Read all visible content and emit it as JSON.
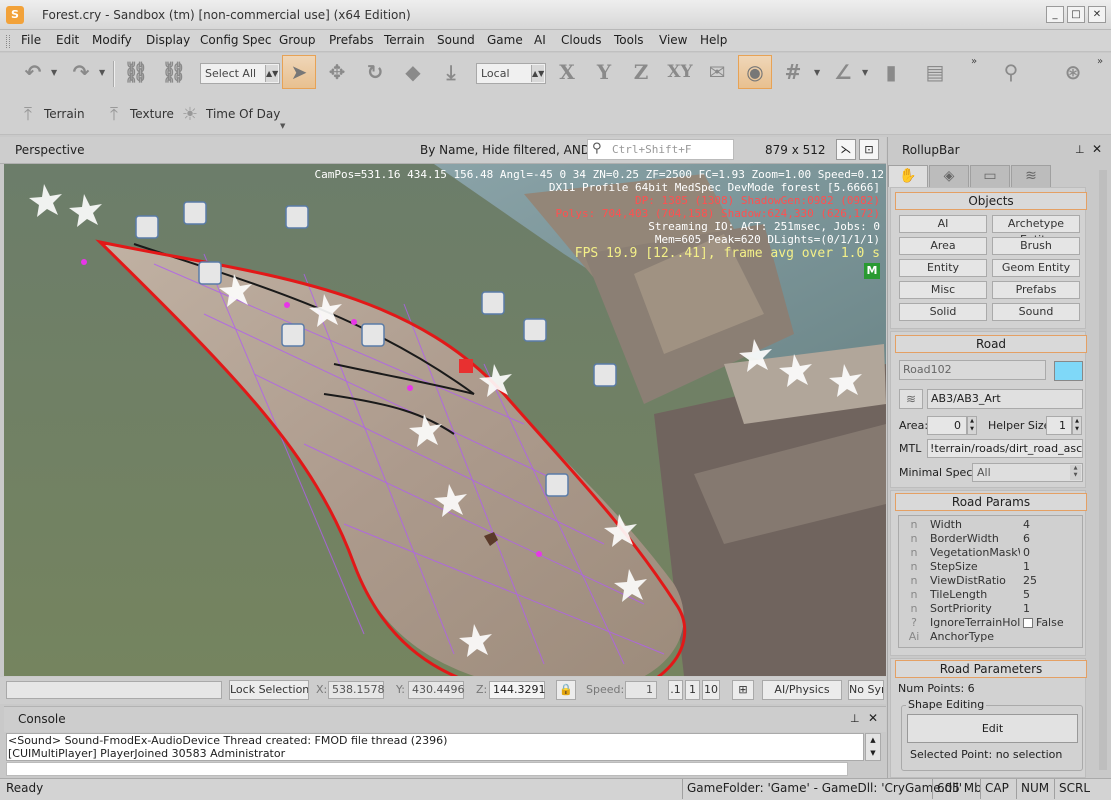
{
  "window": {
    "title": "Forest.cry - Sandbox (tm) [non-commercial use] (x64 Edition)",
    "controls": [
      "_",
      "□",
      "✕"
    ]
  },
  "menu": [
    "File",
    "Edit",
    "Modify",
    "Display",
    "Config Spec",
    "Group",
    "Prefabs",
    "Terrain",
    "Sound",
    "Game",
    "AI",
    "Clouds",
    "Tools",
    "View",
    "Help"
  ],
  "toolbar": {
    "select_filter": "Select All",
    "coord_system": "Local",
    "axis_x": "X",
    "axis_y": "Y",
    "axis_z": "Z",
    "axis_xy": "XY",
    "tools": [
      "undo-icon",
      "redo-icon",
      "link-icon",
      "unlink-icon",
      "select-arrow-icon",
      "move-icon",
      "rotate-icon",
      "scale-icon",
      "terrain-snap-icon",
      "snap-object-icon",
      "eye-view-icon",
      "grid-icon",
      "angle-snap-icon",
      "ruler-icon"
    ]
  },
  "toolbar2": {
    "terrain": "Terrain",
    "texture": "Texture",
    "time_of_day": "Time Of Day"
  },
  "viewport": {
    "title": "Perspective",
    "filter_text": "By Name, Hide filtered, AND",
    "search_placeholder": "Ctrl+Shift+F",
    "resolution": "879 x 512",
    "hud": {
      "line1": "CamPos=531.16 434.15 156.48 Angl=-45  0  34 ZN=0.25 ZF=2500 FC=1.93 Zoom=1.00 Speed=0.12",
      "line2": "DX11 Profile 64bit MedSpec DevMode forest [5.6666]",
      "line3": "DP: 1385 (1308) ShadowGen:0982 (0982)",
      "line4": "Polys: 704,403 (704,158) Shadow:624,330 (626,172)",
      "line5": "Streaming IO: ACT: 251msec, Jobs: 0",
      "line6": "Mem=605 Peak=620 DLights=(0/1/1/1)",
      "fps": "FPS 19.9 [12..41], frame avg over 1.0 s",
      "badge": "M"
    }
  },
  "viewport_status": {
    "lock_selection": "Lock Selection",
    "x_label": "X:",
    "x_value": "538.1578",
    "y_label": "Y:",
    "y_value": "430.4496",
    "z_label": "Z:",
    "z_value": "144.3291",
    "speed_label": "Speed:",
    "speed_value": "1",
    "speed_options": [
      ".1",
      "1",
      "10"
    ],
    "ai_physics": "AI/Physics",
    "no_sync": "No Sync"
  },
  "console": {
    "title": "Console",
    "lines": [
      "<Sound> Sound-FmodEx-AudioDevice Thread created: FMOD file thread (2396)",
      "[CUIMultiPlayer] PlayerJoined 30583 Administrator"
    ]
  },
  "statusbar": {
    "ready": "Ready",
    "game_folder": "GameFolder: 'Game' - GameDll: 'CryGame.dll'",
    "memory": "605 Mb",
    "cap": "CAP",
    "num": "NUM",
    "scrl": "SCRL"
  },
  "rollup": {
    "title": "RollupBar",
    "objects_header": "Objects",
    "object_buttons": [
      "AI",
      "Archetype Entity",
      "Area",
      "Brush",
      "Entity",
      "Geom Entity",
      "Misc",
      "Prefabs",
      "Solid",
      "Sound"
    ],
    "road_header": "Road",
    "road_name": "Road102",
    "road_color": "#7fd8f8",
    "layer": "AB3/AB3_Art",
    "area_label": "Area:",
    "area_value": "0",
    "helper_label": "Helper Size:",
    "helper_value": "1",
    "mtl_label": "MTL",
    "mtl_value": "!terrain/roads/dirt_road_ascent",
    "minspec_label": "Minimal Spec:",
    "minspec_value": "All",
    "params_header": "Road Params",
    "params": [
      {
        "icon": "n",
        "key": "Width",
        "value": "4"
      },
      {
        "icon": "n",
        "key": "BorderWidth",
        "value": "6"
      },
      {
        "icon": "n",
        "key": "VegetationMaskWi",
        "value": "0"
      },
      {
        "icon": "n",
        "key": "StepSize",
        "value": "1"
      },
      {
        "icon": "n",
        "key": "ViewDistRatio",
        "value": "25"
      },
      {
        "icon": "n",
        "key": "TileLength",
        "value": "5"
      },
      {
        "icon": "n",
        "key": "SortPriority",
        "value": "1"
      },
      {
        "icon": "?",
        "key": "IgnoreTerrainHole",
        "value": "False"
      },
      {
        "icon": "Ai",
        "key": "AnchorType",
        "value": ""
      }
    ],
    "parameters_header": "Road Parameters",
    "num_points": "Num Points: 6",
    "shape_editing": "Shape Editing",
    "edit": "Edit",
    "selected_point": "Selected Point: no selection"
  },
  "colors": {
    "accent_orange": "#e4a064",
    "selection_red": "#e21818",
    "hud_white": "#ffffff",
    "hud_red": "#ff5050",
    "hud_yellow": "#f4f088"
  }
}
